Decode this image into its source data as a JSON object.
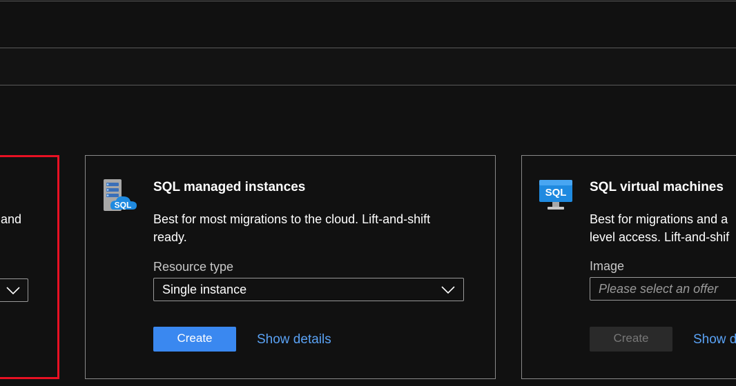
{
  "left_card": {
    "desc_fragment": "and"
  },
  "managed_card": {
    "title": "SQL managed instances",
    "desc_line1": "Best for most migrations to the cloud. Lift-and-shift",
    "desc_line2": "ready.",
    "field_label": "Resource type",
    "select_value": "Single instance",
    "create_label": "Create",
    "details_label": "Show details",
    "icon_text": "SQL"
  },
  "vm_card": {
    "title": "SQL virtual machines",
    "desc_line1": "Best for migrations and a",
    "desc_line2": "level access. Lift-and-shif",
    "field_label": "Image",
    "select_placeholder": "Please select an offer",
    "create_label": "Create",
    "details_label": "Show d",
    "icon_text": "SQL"
  },
  "colors": {
    "background": "#111111",
    "accent": "#3a88f0",
    "link": "#5aa2f5",
    "selected_border": "#e81123"
  }
}
